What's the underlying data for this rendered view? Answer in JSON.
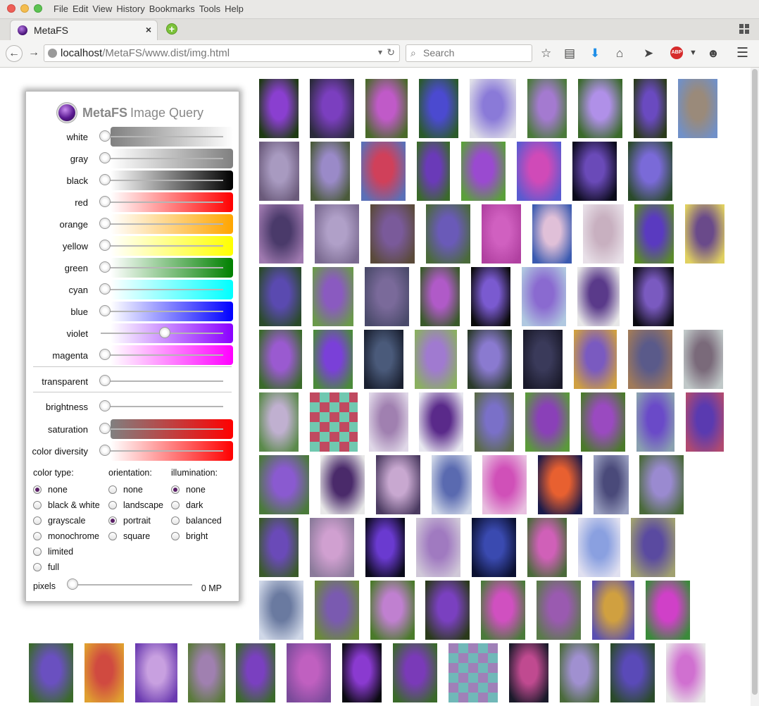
{
  "window": {
    "menu": [
      "File",
      "Edit",
      "View",
      "History",
      "Bookmarks",
      "Tools",
      "Help"
    ]
  },
  "tab": {
    "title": "MetaFS",
    "close": "×",
    "new_tab": "+"
  },
  "nav": {
    "back": "←",
    "forward": "→",
    "url_host": "localhost",
    "url_path": "/MetaFS/www.dist/img.html",
    "search_placeholder": "Search",
    "abp": "ABP"
  },
  "panel": {
    "title_bold": "MetaFS",
    "title_rest": "Image Query",
    "color_sliders": [
      {
        "label": "white",
        "value": 0.0,
        "c1": "#808080",
        "c2": "#ffffff"
      },
      {
        "label": "gray",
        "value": 0.0,
        "c1": "#ffffff",
        "c2": "#808080"
      },
      {
        "label": "black",
        "value": 0.0,
        "c1": "#ffffff",
        "c2": "#000000"
      },
      {
        "label": "red",
        "value": 0.0,
        "c1": "#ffffff",
        "c2": "#ff0000"
      },
      {
        "label": "orange",
        "value": 0.0,
        "c1": "#ffffff",
        "c2": "#ffa500"
      },
      {
        "label": "yellow",
        "value": 0.0,
        "c1": "#ffffff",
        "c2": "#ffff00"
      },
      {
        "label": "green",
        "value": 0.0,
        "c1": "#ffffff",
        "c2": "#008000"
      },
      {
        "label": "cyan",
        "value": 0.0,
        "c1": "#ffffff",
        "c2": "#00ffff"
      },
      {
        "label": "blue",
        "value": 0.0,
        "c1": "#ffffff",
        "c2": "#0000ff"
      },
      {
        "label": "violet",
        "value": 0.5,
        "c1": "#ffffff",
        "c2": "#8a00ff"
      },
      {
        "label": "magenta",
        "value": 0.0,
        "c1": "#ffffff",
        "c2": "#ff00ff"
      }
    ],
    "transparent": {
      "label": "transparent",
      "value": 0.0
    },
    "brightness": {
      "label": "brightness",
      "value": 0.0
    },
    "saturation": {
      "label": "saturation",
      "value": 0.0,
      "c1": "#808080",
      "c2": "#ff0000"
    },
    "diversity": {
      "label": "color diversity",
      "value": 0.0,
      "c1": "#ffffff",
      "c2": "#ff0000"
    },
    "color_type": {
      "heading": "color type:",
      "options": [
        "none",
        "black & white",
        "grayscale",
        "monochrome",
        "limited",
        "full"
      ],
      "selected": 0
    },
    "orientation": {
      "heading": "orientation:",
      "options": [
        "none",
        "landscape",
        "portrait",
        "square"
      ],
      "selected": 2
    },
    "illumination": {
      "heading": "illumination:",
      "options": [
        "none",
        "dark",
        "balanced",
        "bright"
      ],
      "selected": 0
    },
    "pixels": {
      "label": "pixels",
      "value_text": "0 MP",
      "value": 0.0
    }
  },
  "thumbnails": [
    {
      "c1": "#8a3fd0",
      "c2": "#1e3a12"
    },
    {
      "c1": "#7b3fbf",
      "c2": "#2a2a3a"
    },
    {
      "c1": "#c05ac8",
      "c2": "#4a6a2a"
    },
    {
      "c1": "#4b4ad0",
      "c2": "#2a5a2a"
    },
    {
      "c1": "#8a7ad8",
      "c2": "#e0e0e8"
    },
    {
      "c1": "#a47ad0",
      "c2": "#4a7a3a"
    },
    {
      "c1": "#b090e8",
      "c2": "#3a6a2a"
    },
    {
      "c1": "#6a4ac0",
      "c2": "#2a3a1a"
    },
    {
      "c1": "#9a8a7a",
      "c2": "#7090c8"
    },
    {
      "c1": "#a89ac0",
      "c2": "#6a5a7a"
    },
    {
      "c1": "#9a8ac8",
      "c2": "#4a5a3a"
    },
    {
      "c1": "#d0405a",
      "c2": "#5a70b8"
    },
    {
      "c1": "#6a3ab8",
      "c2": "#3a6a2a"
    },
    {
      "c1": "#9a4ad0",
      "c2": "#5aa03a"
    },
    {
      "c1": "#d04ab8",
      "c2": "#5a5ad0"
    },
    {
      "c1": "#6a4ab8",
      "c2": "#0a0a1a"
    },
    {
      "c1": "#7a6ad8",
      "c2": "#2a4a2a"
    },
    {
      "c1": "#4a3a6a",
      "c2": "#a07ab0"
    },
    {
      "c1": "#b0a0c8",
      "c2": "#7a6a90"
    },
    {
      "c1": "#7a5a9a",
      "c2": "#5a4a3a"
    },
    {
      "c1": "#6a5ab8",
      "c2": "#4a6a3a"
    },
    {
      "c1": "#d060c0",
      "c2": "#b040a0"
    },
    {
      "c1": "#e0c0d8",
      "c2": "#3a5ab0"
    },
    {
      "c1": "#c8b0c0",
      "c2": "#e8e0e8"
    },
    {
      "c1": "#5a3ac0",
      "c2": "#5a8a2a"
    },
    {
      "c1": "#6a4a8a",
      "c2": "#e0d060"
    },
    {
      "c1": "#5a4ab0",
      "c2": "#2a4a2a"
    },
    {
      "c1": "#8a5ac0",
      "c2": "#6a9a4a"
    },
    {
      "c1": "#7a6a9a",
      "c2": "#4a4a6a"
    },
    {
      "c1": "#b05ac8",
      "c2": "#3a5a2a"
    },
    {
      "c1": "#7a5ad0",
      "c2": "#0a0a0a"
    },
    {
      "c1": "#8a6ad0",
      "c2": "#b0c8e0"
    },
    {
      "c1": "#5a3a8a",
      "c2": "#e8e8e8"
    },
    {
      "c1": "#7a5ac0",
      "c2": "#0a0a10"
    },
    {
      "c1": "#9a5ad0",
      "c2": "#3a6a2a"
    },
    {
      "c1": "#7a40d8",
      "c2": "#4a8a3a"
    },
    {
      "c1": "#4a5a7a",
      "c2": "#1a2030"
    },
    {
      "c1": "#a07ad0",
      "c2": "#8ab060"
    },
    {
      "c1": "#8a7ad0",
      "c2": "#2a3a2a"
    },
    {
      "c1": "#3a3a5a",
      "c2": "#1a1a2a"
    },
    {
      "c1": "#7a5ac0",
      "c2": "#d0a040"
    },
    {
      "c1": "#5a5a8a",
      "c2": "#a07a5a"
    },
    {
      "c1": "#7a6a7a",
      "c2": "#c0c8c8"
    },
    {
      "c1": "#c0b0d0",
      "c2": "#5a8a4a"
    },
    {
      "c1": "#70c8b0",
      "c2": "#c04a60"
    },
    {
      "c1": "#a080b0",
      "c2": "#e0d8e8"
    },
    {
      "c1": "#5a2a8a",
      "c2": "#e8e8f0"
    },
    {
      "c1": "#7a70c8",
      "c2": "#5a6a4a"
    },
    {
      "c1": "#8a40b8",
      "c2": "#5a9a3a"
    },
    {
      "c1": "#9a4ac0",
      "c2": "#4a7a2a"
    },
    {
      "c1": "#6a4ac8",
      "c2": "#8aa0b0"
    },
    {
      "c1": "#5a3ab0",
      "c2": "#b04a70"
    },
    {
      "c1": "#8a5ad0",
      "c2": "#4a7a3a"
    },
    {
      "c1": "#4a2a6a",
      "c2": "#e8e8e8"
    },
    {
      "c1": "#c8a8d0",
      "c2": "#4a3a60"
    },
    {
      "c1": "#5a6ab0",
      "c2": "#d0d8e8"
    },
    {
      "c1": "#d050b8",
      "c2": "#e8c0e0"
    },
    {
      "c1": "#e86030",
      "c2": "#1a1a4a"
    },
    {
      "c1": "#4a4a7a",
      "c2": "#9aa0c0"
    },
    {
      "c1": "#9a8ad0",
      "c2": "#4a6a3a"
    },
    {
      "c1": "#6a4ab8",
      "c2": "#3a5a2a"
    },
    {
      "c1": "#d0a0d0",
      "c2": "#8a7a9a"
    },
    {
      "c1": "#6a3ad0",
      "c2": "#0a0a1a"
    },
    {
      "c1": "#a07ac0",
      "c2": "#d0c8d8"
    },
    {
      "c1": "#3a4ab0",
      "c2": "#0a1030"
    },
    {
      "c1": "#d060b8",
      "c2": "#4a6a3a"
    },
    {
      "c1": "#8aa0e0",
      "c2": "#e0e0f0"
    },
    {
      "c1": "#5a4aa0",
      "c2": "#a0a070"
    },
    {
      "c1": "#6a7aa0",
      "c2": "#d0d8e8"
    },
    {
      "c1": "#7a5ab0",
      "c2": "#6a8a3a"
    },
    {
      "c1": "#c080d0",
      "c2": "#4a7a2a"
    },
    {
      "c1": "#7a40c0",
      "c2": "#2a3a1a"
    },
    {
      "c1": "#d050c0",
      "c2": "#4a7a3a"
    },
    {
      "c1": "#9a5ab0",
      "c2": "#5a7a4a"
    },
    {
      "c1": "#d0a040",
      "c2": "#5a50b0"
    },
    {
      "c1": "#d040c8",
      "c2": "#3a8a3a"
    },
    {
      "c1": "#6a50c0",
      "c2": "#3a6a2a"
    },
    {
      "c1": "#d04a40",
      "c2": "#e0a030"
    },
    {
      "c1": "#c8a0e0",
      "c2": "#6a3ab0"
    },
    {
      "c1": "#a080b0",
      "c2": "#5a7a3a"
    },
    {
      "c1": "#7a40c0",
      "c2": "#3a6a2a"
    },
    {
      "c1": "#c060c0",
      "c2": "#7a4a9a"
    },
    {
      "c1": "#8a3ad0",
      "c2": "#0a0a10"
    },
    {
      "c1": "#7a3ab8",
      "c2": "#3a6a2a"
    },
    {
      "c1": "#70b8b8",
      "c2": "#a080b8"
    },
    {
      "c1": "#c04a90",
      "c2": "#1a1a2a"
    },
    {
      "c1": "#a090d0",
      "c2": "#4a6a3a"
    },
    {
      "c1": "#5a4ab8",
      "c2": "#2a4a2a"
    },
    {
      "c1": "#d070d0",
      "c2": "#e8e8e8"
    }
  ]
}
